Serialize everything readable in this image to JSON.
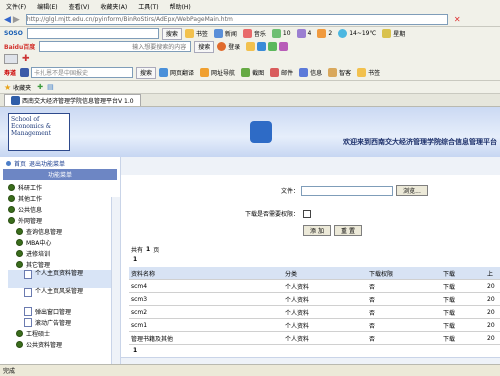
{
  "menu": [
    "文件(F)",
    "编辑(E)",
    "查看(V)",
    "收藏夹(A)",
    "工具(T)",
    "帮助(H)"
  ],
  "address": {
    "url": "http://glgl.mjtt.edu.cn/pyinform/BinRoStirs/AdEpx/WebPageMain.htm"
  },
  "toolbar1": {
    "soso": "SOSO",
    "search_btn": "搜索",
    "items": [
      "书签",
      "新闻",
      "音乐",
      "10",
      "4",
      "2",
      "14~19℃",
      "星期"
    ]
  },
  "toolbar2": {
    "baidu": "Baidu百度",
    "placeholder": "输入想要搜索的内容",
    "search_btn": "搜索",
    "items": [
      "登录"
    ]
  },
  "toolbar4": {
    "brand": "寿道",
    "placeholder": "卡扎恩不是中国报史",
    "search_btn": "搜索",
    "items": [
      "网页翻译",
      "网址导航",
      "截图",
      "邮件",
      "信息",
      "智客",
      "书签"
    ]
  },
  "tabbar": {
    "favorites": "收藏夹"
  },
  "tab": {
    "title": "西南交大经济管理学院信息管理平台V 1.0"
  },
  "banner": {
    "logo": "School of Economics & Management",
    "title": "欢迎来到西南交大经济管理学院综合信息管理平台"
  },
  "sidebar": {
    "top_links": [
      "首页",
      "退出功能菜单"
    ],
    "header": "功能菜单",
    "items": [
      {
        "label": "科研工作",
        "level": 0
      },
      {
        "label": "其他工作",
        "level": 0
      },
      {
        "label": "公共信息",
        "level": 0
      },
      {
        "label": "外网管理",
        "level": 0
      },
      {
        "label": "查询信息管理",
        "level": 1
      },
      {
        "label": "MBA中心",
        "level": 1
      },
      {
        "label": "进修培训",
        "level": 1
      },
      {
        "label": "其它管理",
        "level": 1
      },
      {
        "label": "个人主页资料管理",
        "level": 2
      },
      {
        "label": "个人主页风采管理",
        "level": 2
      },
      {
        "label": "弹出窗口管理",
        "level": 2
      },
      {
        "label": "滚动广告管理",
        "level": 2
      },
      {
        "label": "工程硕士",
        "level": 1
      },
      {
        "label": "公共资料管理",
        "level": 1
      }
    ]
  },
  "form": {
    "file_label": "文件：",
    "browse_btn": "浏览...",
    "download_label": "下载是否需要权限：",
    "add_btn": "添 加",
    "reset_btn": "重 置"
  },
  "list": {
    "total_prefix": "共有",
    "total_count": "1",
    "total_suffix": "页",
    "page_number": "1",
    "columns": [
      "资料名称",
      "分类",
      "下载权限",
      "下载",
      "上"
    ],
    "rows": [
      [
        "scm4",
        "个人资料",
        "否",
        "下载",
        "20"
      ],
      [
        "scm3",
        "个人资料",
        "否",
        "下载",
        "20"
      ],
      [
        "scm2",
        "个人资料",
        "否",
        "下载",
        "20"
      ],
      [
        "scm1",
        "个人资料",
        "否",
        "下载",
        "20"
      ],
      [
        "管理书籍及其他",
        "个人资料",
        "否",
        "下载",
        "20"
      ]
    ],
    "footer_page": "1"
  },
  "status": {
    "text": "完成"
  }
}
